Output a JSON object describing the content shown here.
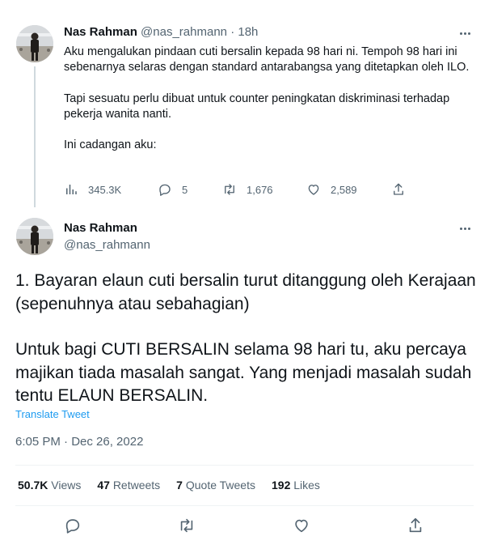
{
  "tweet1": {
    "name": "Nas Rahman",
    "handle": "@nas_rahmann",
    "separator": "·",
    "time": "18h",
    "paragraphs": [
      "Aku mengalukan pindaan cuti bersalin kepada 98 hari ni. Tempoh 98 hari ini sebenarnya selaras dengan standard antarabangsa yang ditetapkan oleh ILO.",
      "Tapi sesuatu perlu dibuat untuk counter peningkatan diskriminasi terhadap pekerja wanita nanti.",
      "Ini cadangan aku:"
    ],
    "actions": {
      "views": "345.3K",
      "replies": "5",
      "retweets": "1,676",
      "likes": "2,589"
    }
  },
  "tweet2": {
    "name": "Nas Rahman",
    "handle": "@nas_rahmann",
    "paragraphs": [
      "1.  Bayaran elaun cuti bersalin turut ditanggung oleh Kerajaan (sepenuhnya atau sebahagian)",
      "Untuk bagi CUTI BERSALIN selama 98 hari tu, aku percaya majikan tiada masalah sangat. Yang menjadi masalah sudah tentu ELAUN BERSALIN."
    ],
    "translate_label": "Translate Tweet",
    "datetime": "6:05 PM · Dec 26, 2022",
    "stats": {
      "views_count": "50.7K",
      "views_label": "Views",
      "retweets_count": "47",
      "retweets_label": "Retweets",
      "quotes_count": "7",
      "quotes_label": "Quote Tweets",
      "likes_count": "192",
      "likes_label": "Likes"
    }
  },
  "colors": {
    "accent": "#1d9bf0",
    "text": "#0f1419",
    "muted": "#536471",
    "divider": "#eff3f4",
    "thread_line": "#cfd9de"
  },
  "icons": [
    "more-icon",
    "views-icon",
    "reply-icon",
    "retweet-icon",
    "like-icon",
    "share-icon"
  ]
}
